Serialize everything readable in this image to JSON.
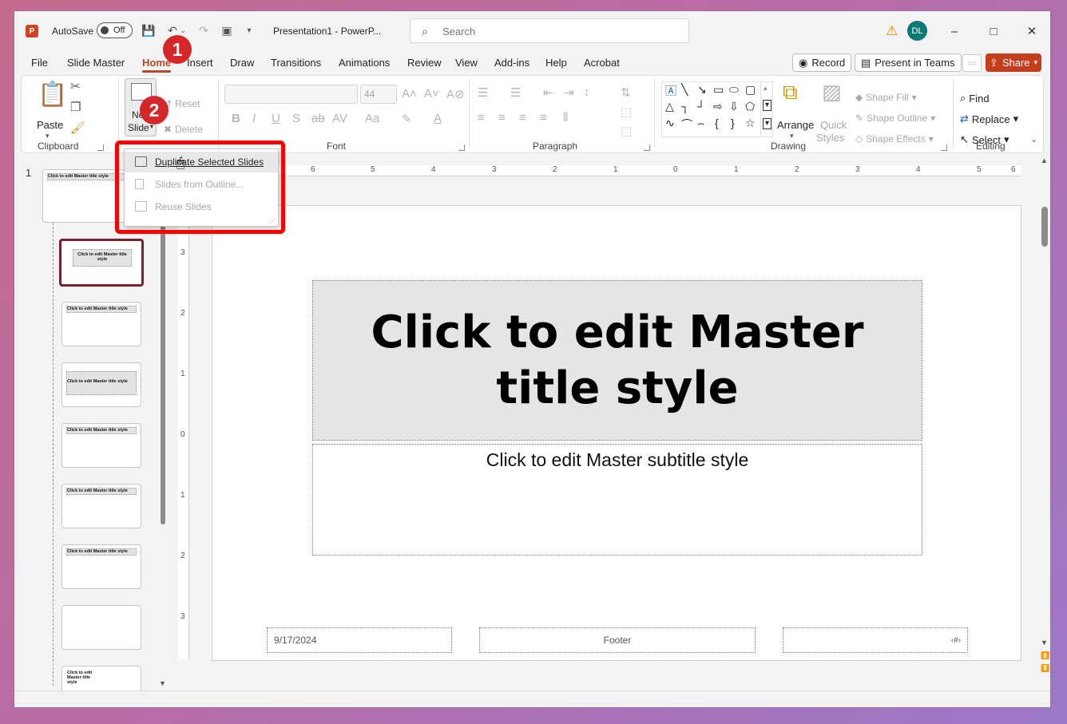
{
  "titlebar": {
    "autosave_label": "AutoSave",
    "autosave_state": "Off",
    "doc_title": "Presentation1  -  PowerP...",
    "search_placeholder": "Search",
    "user_initials": "DL"
  },
  "menu": {
    "tabs": [
      "File",
      "Slide Master",
      "Home",
      "Insert",
      "Draw",
      "Transitions",
      "Animations",
      "Review",
      "View",
      "Add-ins",
      "Help",
      "Acrobat"
    ],
    "active_tab": "Home",
    "record_label": "Record",
    "present_label": "Present in Teams",
    "share_label": "Share"
  },
  "ribbon": {
    "clipboard": {
      "label": "Clipboard",
      "paste": "Paste"
    },
    "slides": {
      "new_slide_1": "New",
      "new_slide_2": "Slide",
      "reset": "Reset",
      "delete": "Delete"
    },
    "font": {
      "label": "Font",
      "size": "44"
    },
    "paragraph": {
      "label": "Paragraph"
    },
    "drawing": {
      "label": "Drawing",
      "arrange": "Arrange",
      "quick_styles_1": "Quick",
      "quick_styles_2": "Styles",
      "shape_fill": "Shape Fill",
      "shape_outline": "Shape Outline",
      "shape_effects": "Shape Effects"
    },
    "editing": {
      "label": "Editing",
      "find": "Find",
      "replace": "Replace",
      "select": "Select"
    }
  },
  "dropdown": {
    "items": [
      {
        "label": "Duplicate Selected Slides",
        "enabled": true
      },
      {
        "label": "Slides from Outline...",
        "enabled": false
      },
      {
        "label": "Reuse Slides",
        "enabled": false
      }
    ]
  },
  "annotations": {
    "badge1": "1",
    "badge2": "2"
  },
  "slide_panel": {
    "slide_number": "1",
    "master_thumb_title": "Click to edit Master title style",
    "layout_thumb_titles": [
      "Click to edit Master title style",
      "Click to edit Master title style",
      "Click to edit Master title style",
      "Click to edit Master title style",
      "Click to edit Master title style",
      "Click to edit Master title style",
      "",
      "Click to edit Master title style"
    ]
  },
  "slide": {
    "title": "Click to edit Master title style",
    "subtitle": "Click to edit Master subtitle style",
    "date": "9/17/2024",
    "footer": "Footer",
    "slide_num_placeholder": "‹#›"
  },
  "hruler_numbers": [
    "6",
    "5",
    "4",
    "3",
    "2",
    "1",
    "0",
    "1",
    "2",
    "3",
    "4",
    "5",
    "6"
  ],
  "vruler_numbers": [
    "3",
    "2",
    "1",
    "0",
    "1",
    "2",
    "3"
  ],
  "colors": {
    "accent": "#b7472a",
    "share": "#c43e1c",
    "highlight": "#ff0000"
  }
}
